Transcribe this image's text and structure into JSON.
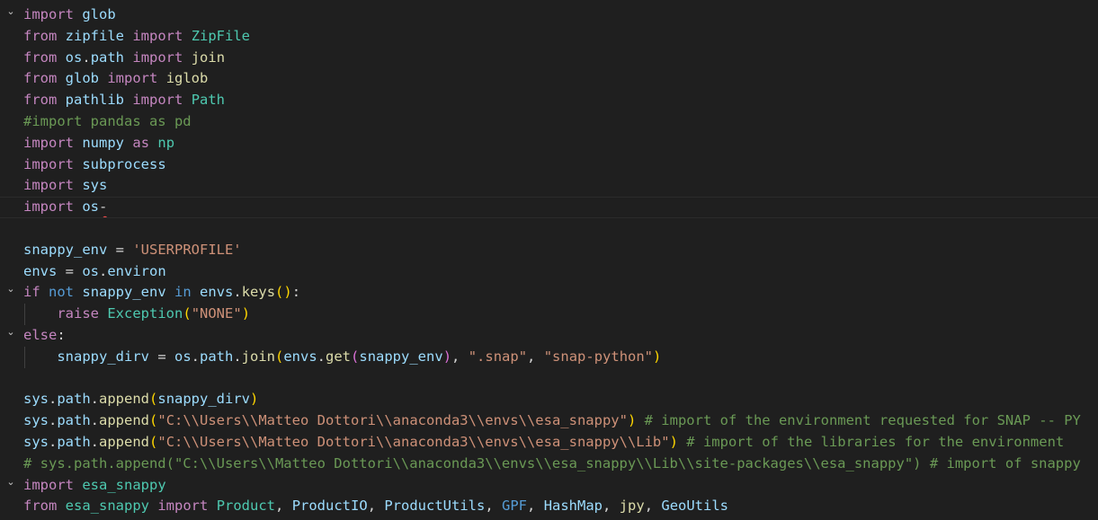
{
  "editor": {
    "language": "python",
    "fold_icon": "chevron-down-icon",
    "lines": [
      {
        "fold": true,
        "tokens": [
          [
            "kw",
            "import"
          ],
          [
            "op",
            " "
          ],
          [
            "vr",
            "glob"
          ]
        ]
      },
      {
        "fold": false,
        "tokens": [
          [
            "kw",
            "from"
          ],
          [
            "op",
            " "
          ],
          [
            "vr",
            "zipfile"
          ],
          [
            "op",
            " "
          ],
          [
            "kw",
            "import"
          ],
          [
            "op",
            " "
          ],
          [
            "cl",
            "ZipFile"
          ]
        ]
      },
      {
        "fold": false,
        "tokens": [
          [
            "kw",
            "from"
          ],
          [
            "op",
            " "
          ],
          [
            "vr",
            "os"
          ],
          [
            "op",
            "."
          ],
          [
            "vr",
            "path"
          ],
          [
            "op",
            " "
          ],
          [
            "kw",
            "import"
          ],
          [
            "op",
            " "
          ],
          [
            "fn",
            "join"
          ]
        ]
      },
      {
        "fold": false,
        "tokens": [
          [
            "kw",
            "from"
          ],
          [
            "op",
            " "
          ],
          [
            "vr",
            "glob"
          ],
          [
            "op",
            " "
          ],
          [
            "kw",
            "import"
          ],
          [
            "op",
            " "
          ],
          [
            "fn",
            "iglob"
          ]
        ]
      },
      {
        "fold": false,
        "tokens": [
          [
            "kw",
            "from"
          ],
          [
            "op",
            " "
          ],
          [
            "vr",
            "pathlib"
          ],
          [
            "op",
            " "
          ],
          [
            "kw",
            "import"
          ],
          [
            "op",
            " "
          ],
          [
            "cl",
            "Path"
          ]
        ]
      },
      {
        "fold": false,
        "tokens": [
          [
            "cm",
            "#import pandas as pd"
          ]
        ]
      },
      {
        "fold": false,
        "tokens": [
          [
            "kw",
            "import"
          ],
          [
            "op",
            " "
          ],
          [
            "vr",
            "numpy"
          ],
          [
            "op",
            " "
          ],
          [
            "kw",
            "as"
          ],
          [
            "op",
            " "
          ],
          [
            "cl",
            "np"
          ]
        ]
      },
      {
        "fold": false,
        "tokens": [
          [
            "kw",
            "import"
          ],
          [
            "op",
            " "
          ],
          [
            "vr",
            "subprocess"
          ]
        ]
      },
      {
        "fold": false,
        "tokens": [
          [
            "kw",
            "import"
          ],
          [
            "op",
            " "
          ],
          [
            "vr",
            "sys"
          ]
        ]
      },
      {
        "fold": false,
        "current": true,
        "tokens": [
          [
            "kw",
            "import"
          ],
          [
            "op",
            " "
          ],
          [
            "vr",
            "os"
          ],
          [
            "op squig",
            "-"
          ]
        ]
      },
      {
        "fold": false,
        "tokens": []
      },
      {
        "fold": false,
        "tokens": [
          [
            "vr",
            "snappy_env"
          ],
          [
            "op",
            " = "
          ],
          [
            "st",
            "'USERPROFILE'"
          ]
        ]
      },
      {
        "fold": false,
        "tokens": [
          [
            "vr",
            "envs"
          ],
          [
            "op",
            " = "
          ],
          [
            "vr",
            "os"
          ],
          [
            "op",
            "."
          ],
          [
            "vr",
            "environ"
          ]
        ]
      },
      {
        "fold": true,
        "tokens": [
          [
            "kw",
            "if"
          ],
          [
            "op",
            " "
          ],
          [
            "kwb",
            "not"
          ],
          [
            "op",
            " "
          ],
          [
            "vr",
            "snappy_env"
          ],
          [
            "op",
            " "
          ],
          [
            "kwb",
            "in"
          ],
          [
            "op",
            " "
          ],
          [
            "vr",
            "envs"
          ],
          [
            "op",
            "."
          ],
          [
            "fn",
            "keys"
          ],
          [
            "p1",
            "()"
          ],
          [
            "op",
            ":"
          ]
        ]
      },
      {
        "fold": false,
        "guide": true,
        "tokens": [
          [
            "op",
            "    "
          ],
          [
            "kw",
            "raise"
          ],
          [
            "op",
            " "
          ],
          [
            "cl",
            "Exception"
          ],
          [
            "p1",
            "("
          ],
          [
            "st",
            "\"NONE\""
          ],
          [
            "p1",
            ")"
          ]
        ]
      },
      {
        "fold": true,
        "tokens": [
          [
            "kw",
            "else"
          ],
          [
            "op",
            ":"
          ]
        ]
      },
      {
        "fold": false,
        "guide": true,
        "tokens": [
          [
            "op",
            "    "
          ],
          [
            "vr",
            "snappy_dirv"
          ],
          [
            "op",
            " = "
          ],
          [
            "vr",
            "os"
          ],
          [
            "op",
            "."
          ],
          [
            "vr",
            "path"
          ],
          [
            "op",
            "."
          ],
          [
            "fn",
            "join"
          ],
          [
            "p1",
            "("
          ],
          [
            "vr",
            "envs"
          ],
          [
            "op",
            "."
          ],
          [
            "fn",
            "get"
          ],
          [
            "p2",
            "("
          ],
          [
            "vr",
            "snappy_env"
          ],
          [
            "p2",
            ")"
          ],
          [
            "op",
            ", "
          ],
          [
            "st",
            "\".snap\""
          ],
          [
            "op",
            ", "
          ],
          [
            "st",
            "\"snap-python\""
          ],
          [
            "p1",
            ")"
          ]
        ]
      },
      {
        "fold": false,
        "tokens": []
      },
      {
        "fold": false,
        "tokens": [
          [
            "vr",
            "sys"
          ],
          [
            "op",
            "."
          ],
          [
            "vr",
            "path"
          ],
          [
            "op",
            "."
          ],
          [
            "fn",
            "append"
          ],
          [
            "p1",
            "("
          ],
          [
            "vr",
            "snappy_dirv"
          ],
          [
            "p1",
            ")"
          ]
        ]
      },
      {
        "fold": false,
        "tokens": [
          [
            "vr",
            "sys"
          ],
          [
            "op",
            "."
          ],
          [
            "vr",
            "path"
          ],
          [
            "op",
            "."
          ],
          [
            "fn",
            "append"
          ],
          [
            "p1",
            "("
          ],
          [
            "st",
            "\"C:\\\\Users\\\\Matteo Dottori\\\\anaconda3\\\\envs\\\\esa_snappy\""
          ],
          [
            "p1",
            ")"
          ],
          [
            "op",
            " "
          ],
          [
            "cm",
            "# import of the environment requested for SNAP -- PY"
          ]
        ]
      },
      {
        "fold": false,
        "tokens": [
          [
            "vr",
            "sys"
          ],
          [
            "op",
            "."
          ],
          [
            "vr",
            "path"
          ],
          [
            "op",
            "."
          ],
          [
            "fn",
            "append"
          ],
          [
            "p1",
            "("
          ],
          [
            "st",
            "\"C:\\\\Users\\\\Matteo Dottori\\\\anaconda3\\\\envs\\\\esa_snappy\\\\Lib\""
          ],
          [
            "p1",
            ")"
          ],
          [
            "op",
            " "
          ],
          [
            "cm",
            "# import of the libraries for the environment"
          ]
        ]
      },
      {
        "fold": false,
        "tokens": [
          [
            "cm",
            "# sys.path.append(\"C:\\\\Users\\\\Matteo Dottori\\\\anaconda3\\\\envs\\\\esa_snappy\\\\Lib\\\\site-packages\\\\esa_snappy\") # import of snappy"
          ]
        ]
      },
      {
        "fold": true,
        "tokens": [
          [
            "kw",
            "import"
          ],
          [
            "op",
            " "
          ],
          [
            "cl",
            "esa_snappy"
          ]
        ]
      },
      {
        "fold": false,
        "tokens": [
          [
            "kw",
            "from"
          ],
          [
            "op",
            " "
          ],
          [
            "cl",
            "esa_snappy"
          ],
          [
            "op",
            " "
          ],
          [
            "kw",
            "import"
          ],
          [
            "op",
            " "
          ],
          [
            "cl",
            "Product"
          ],
          [
            "op",
            ", "
          ],
          [
            "vr",
            "ProductIO"
          ],
          [
            "op",
            ", "
          ],
          [
            "vr",
            "ProductUtils"
          ],
          [
            "op",
            ", "
          ],
          [
            "kwb",
            "GPF"
          ],
          [
            "op",
            ", "
          ],
          [
            "vr",
            "HashMap"
          ],
          [
            "op",
            ", "
          ],
          [
            "fn",
            "jpy"
          ],
          [
            "op",
            ", "
          ],
          [
            "vr",
            "GeoUtils"
          ]
        ]
      }
    ]
  }
}
